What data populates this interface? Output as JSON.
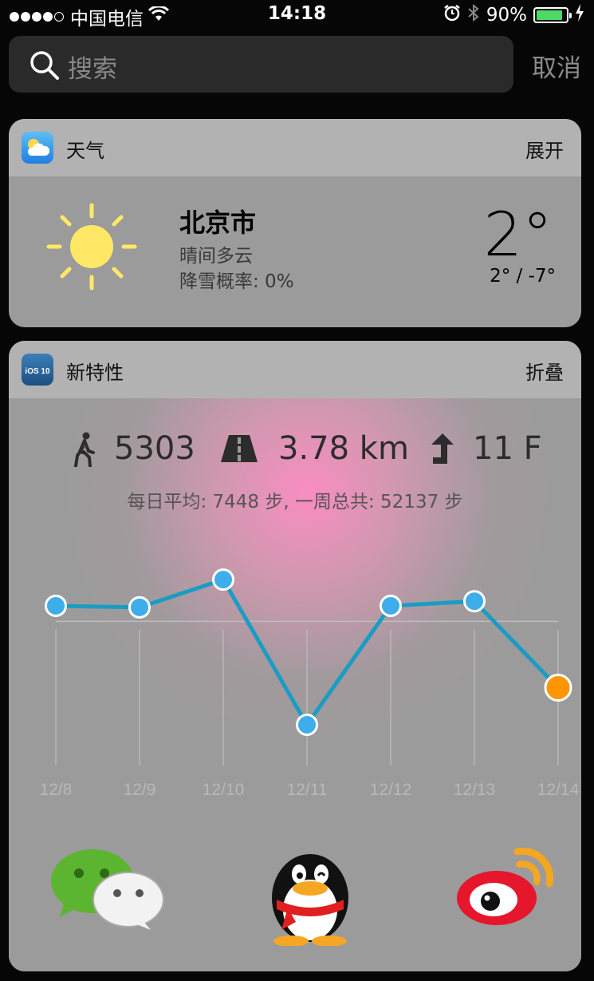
{
  "status_bar": {
    "carrier": "中国电信",
    "time": "14:18",
    "battery_percent": "90%",
    "battery_level": 0.9
  },
  "search": {
    "placeholder": "搜索",
    "cancel_label": "取消"
  },
  "weather_widget": {
    "title": "天气",
    "action": "展开",
    "city": "北京市",
    "condition": "晴间多云",
    "snow_chance": "降雪概率: 0%",
    "temperature": "2°",
    "range": "2° / -7°"
  },
  "features_widget": {
    "title": "新特性",
    "action": "折叠",
    "app_icon_text": "iOS 10",
    "steps": "5303",
    "distance": "3.78 km",
    "floors": "11 F",
    "summary": "每日平均: 7448 步, 一周总共: 52137 步",
    "apps": [
      "wechat-icon",
      "qq-icon",
      "weibo-icon"
    ]
  },
  "chart_data": {
    "type": "line",
    "categories": [
      "12/8",
      "12/9",
      "12/10",
      "12/11",
      "12/12",
      "12/13",
      "12/14"
    ],
    "values": [
      7950,
      7900,
      8800,
      4100,
      7950,
      8100,
      5303
    ],
    "ylim": [
      3300,
      9500
    ],
    "average": 7448,
    "highlight_index": 6,
    "colors": {
      "line": "#1a9cc4",
      "point": "#3daeea",
      "highlight": "#ff9500"
    }
  }
}
